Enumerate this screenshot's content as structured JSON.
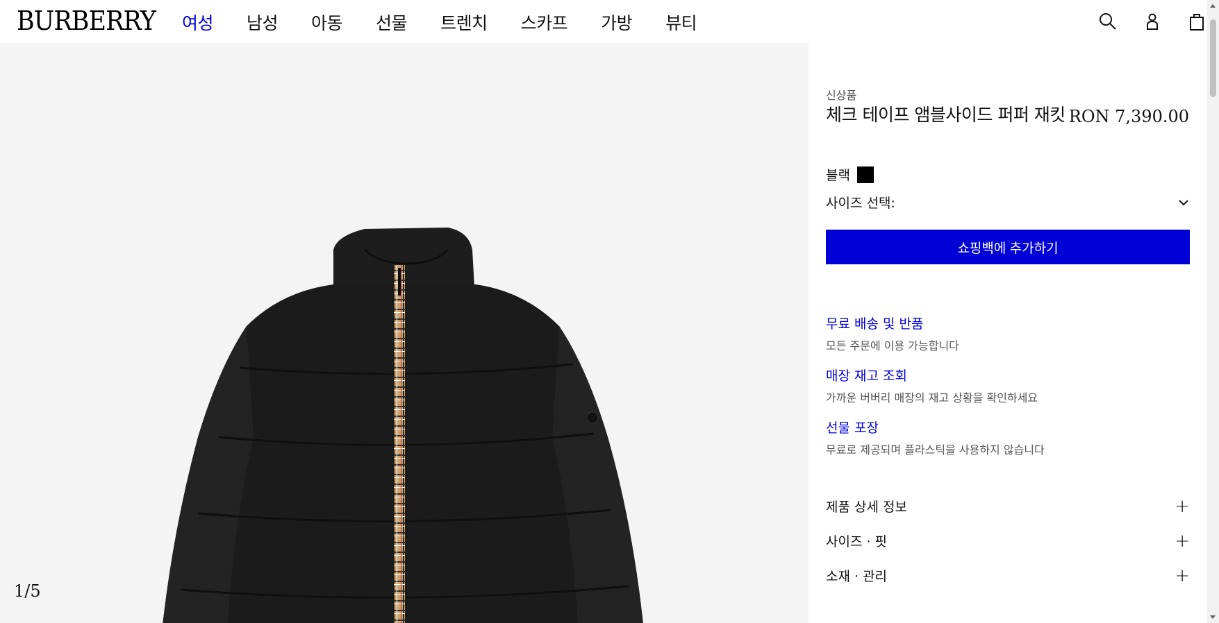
{
  "header": {
    "logo": "BURBERRY",
    "nav": [
      "여성",
      "남성",
      "아동",
      "선물",
      "트렌치",
      "스카프",
      "가방",
      "뷰티"
    ],
    "active_index": 0,
    "icons": [
      "search-icon",
      "account-icon",
      "shopping-bag-icon"
    ]
  },
  "gallery": {
    "counter": "1/5"
  },
  "product": {
    "badge": "신상품",
    "title": "체크 테이프 앰블사이드 퍼퍼 재킷",
    "price": "RON 7,390.00",
    "color_label": "블랙",
    "color_hex": "#000000",
    "size_label": "사이즈 선택:",
    "add_button": "쇼핑백에 추가하기"
  },
  "services": [
    {
      "title": "무료 배송 및 반품",
      "desc": "모든 주문에 이용 가능합니다"
    },
    {
      "title": "매장 재고 조회",
      "desc": "가까운 버버리 매장의 재고 상황을 확인하세요"
    },
    {
      "title": "선물 포장",
      "desc": "무료로 제공되며 플라스틱을 사용하지 않습니다"
    }
  ],
  "accordions": [
    "제품 상세 정보",
    "사이즈 · 핏",
    "소재 · 관리"
  ],
  "colors": {
    "accent": "#0000d6",
    "image_bg": "#f4f4f4"
  }
}
